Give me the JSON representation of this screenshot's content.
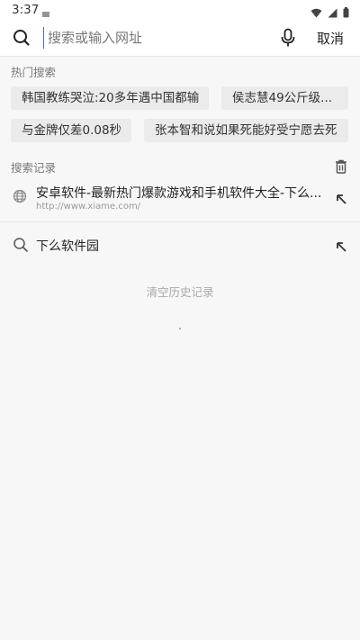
{
  "status": {
    "time": "3:37"
  },
  "search": {
    "placeholder": "搜索或输入网址",
    "cancel_label": "取消"
  },
  "hot": {
    "title": "热门搜索",
    "chips": [
      "韩国教练哭泣:20多年遇中国都输",
      "侯志慧49公斤级...",
      "与金牌仅差0.08秒",
      "张本智和说如果死能好受宁愿去死"
    ]
  },
  "history": {
    "title": "搜索记录",
    "items": [
      {
        "title": "安卓软件-最新热门爆款游戏和手机软件大全-下么...",
        "url": "http://www.xiame.com/",
        "icon": "globe-icon"
      },
      {
        "title": "下么软件园",
        "icon": "search-icon"
      }
    ],
    "clear_label": "清空历史记录"
  }
}
